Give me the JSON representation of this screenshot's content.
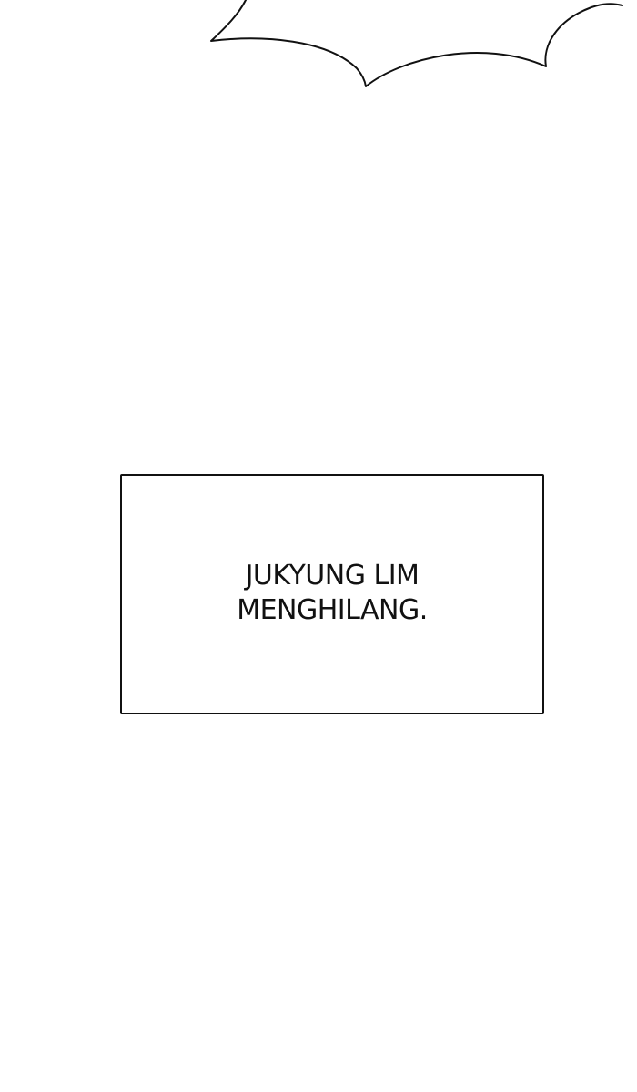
{
  "colors": {
    "background": "#ffffff",
    "ink": "#111111"
  },
  "caption": {
    "lines": [
      "JUKYUNG LIM",
      "MENGHILANG."
    ]
  }
}
